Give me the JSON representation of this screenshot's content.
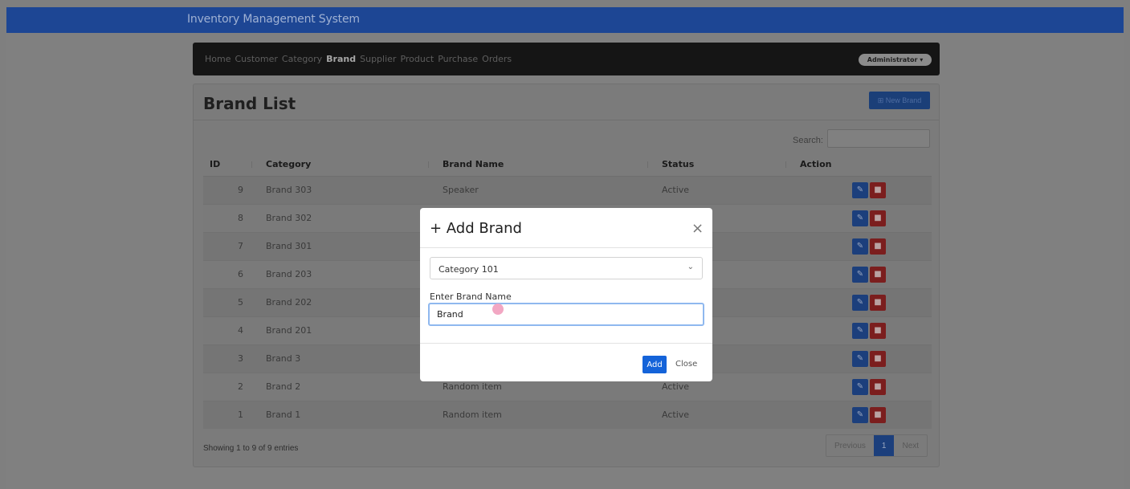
{
  "app": {
    "title": "Inventory Management System"
  },
  "nav": {
    "items": [
      "Home",
      "Customer",
      "Category",
      "Brand",
      "Supplier",
      "Product",
      "Purchase",
      "Orders"
    ],
    "active": "Brand",
    "user_menu": "Administrator"
  },
  "brand_list": {
    "title": "Brand List",
    "new_button": "New Brand",
    "search_label": "Search:",
    "columns": [
      "ID",
      "Category",
      "Brand Name",
      "Status",
      "Action"
    ],
    "rows": [
      {
        "id": "9",
        "category": "Brand 303",
        "brand_name": "Speaker",
        "status": "Active"
      },
      {
        "id": "8",
        "category": "Brand 302",
        "brand_name": "",
        "status": ""
      },
      {
        "id": "7",
        "category": "Brand 301",
        "brand_name": "",
        "status": ""
      },
      {
        "id": "6",
        "category": "Brand 203",
        "brand_name": "",
        "status": ""
      },
      {
        "id": "5",
        "category": "Brand 202",
        "brand_name": "",
        "status": ""
      },
      {
        "id": "4",
        "category": "Brand 201",
        "brand_name": "",
        "status": ""
      },
      {
        "id": "3",
        "category": "Brand 3",
        "brand_name": "",
        "status": ""
      },
      {
        "id": "2",
        "category": "Brand 2",
        "brand_name": "Random item",
        "status": "Active"
      },
      {
        "id": "1",
        "category": "Brand 1",
        "brand_name": "Random item",
        "status": "Active"
      }
    ],
    "showing": "Showing 1 to 9 of 9 entries",
    "pager": {
      "previous": "Previous",
      "current": "1",
      "next": "Next"
    }
  },
  "modal": {
    "title": "+ Add Brand",
    "close_icon": "×",
    "category_value": "Category 101",
    "brand_label": "Enter Brand Name",
    "brand_value": "Brand",
    "add_label": "Add",
    "close_label": "Close"
  },
  "icons": {
    "edit": "edit-icon",
    "delete": "trash-icon",
    "dropdown": "chevron-down-icon"
  },
  "colors": {
    "topbar": "#1d4694",
    "primary": "#1463d9",
    "danger": "#dc3545"
  }
}
